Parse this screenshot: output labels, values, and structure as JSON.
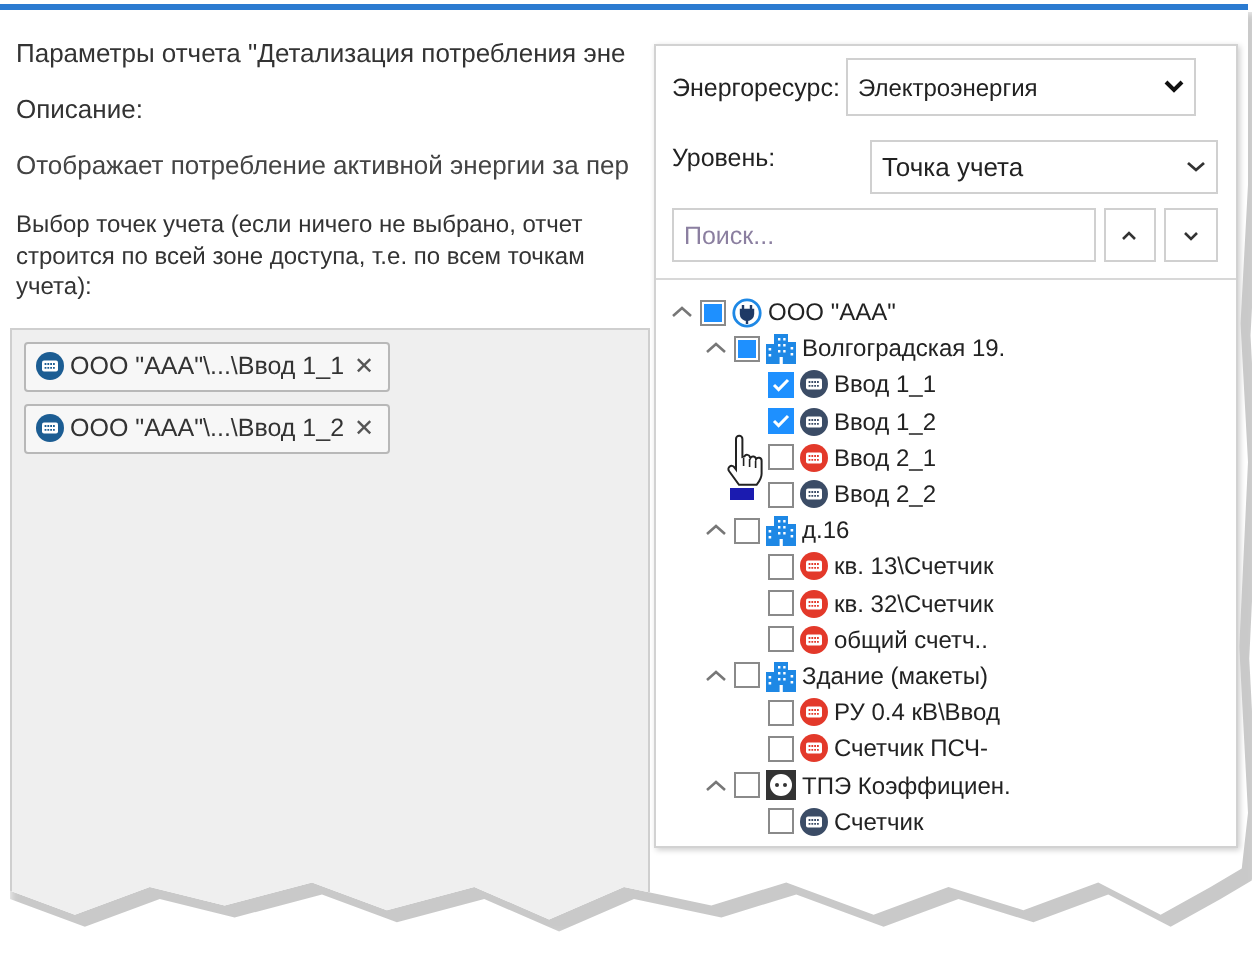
{
  "report": {
    "title": "Параметры отчета \"Детализация потребления эне",
    "description_label": "Описание:",
    "description": "Отображает потребление активной энергии за пер",
    "selection_hint": "Выбор точек учета (если ничего не выбрано, отчет строится по всей зоне доступа, т.е. по всем точкам учета):",
    "chips": [
      {
        "label": "ООО \"AAA\"\\...\\Ввод 1_1",
        "remove": "✕"
      },
      {
        "label": "ООО \"AAA\"\\...\\Ввод 1_2",
        "remove": "✕"
      }
    ]
  },
  "picker": {
    "resource_label": "Энергоресурс:",
    "resource_value": "Электроэнергия",
    "level_label": "Уровень:",
    "level_value": "Точка учета",
    "search": {
      "placeholder": "Поиск..."
    },
    "tree": [
      {
        "label": "ООО \"AAA\"",
        "kind": "organization",
        "checked": false,
        "partial": true,
        "expanded": true,
        "children": [
          {
            "label": "Волгоградская 19.",
            "kind": "building",
            "checked": false,
            "partial": true,
            "expanded": true,
            "children": [
              {
                "label": "Ввод 1_1",
                "kind": "meter",
                "color": "#3b4c66",
                "checked": true
              },
              {
                "label": "Ввод 1_2",
                "kind": "meter",
                "color": "#3b4c66",
                "checked": true
              },
              {
                "label": "Ввод 2_1",
                "kind": "meter",
                "color": "#e3392a",
                "checked": false
              },
              {
                "label": "Ввод 2_2",
                "kind": "meter",
                "color": "#3b4c66",
                "checked": false
              }
            ]
          },
          {
            "label": "д.16",
            "kind": "building",
            "checked": false,
            "partial": false,
            "expanded": true,
            "children": [
              {
                "label": "кв. 13\\Счетчик",
                "kind": "meter",
                "color": "#e3392a",
                "checked": false
              },
              {
                "label": "кв. 32\\Счетчик",
                "kind": "meter",
                "color": "#e3392a",
                "checked": false
              },
              {
                "label": "общий счетч..",
                "kind": "meter",
                "color": "#e3392a",
                "checked": false
              }
            ]
          },
          {
            "label": "Здание (макеты)",
            "kind": "building",
            "checked": false,
            "partial": false,
            "expanded": true,
            "children": [
              {
                "label": "РУ 0.4 кВ\\Ввод",
                "kind": "meter",
                "color": "#e3392a",
                "checked": false
              },
              {
                "label": "Счетчик ПСЧ-",
                "kind": "meter",
                "color": "#e3392a",
                "checked": false
              }
            ]
          },
          {
            "label": "ТПЭ Коэффициен.",
            "kind": "substation",
            "checked": false,
            "partial": false,
            "expanded": true,
            "children": [
              {
                "label": "Счетчик",
                "kind": "meter",
                "color": "#3b4c66",
                "checked": false
              }
            ]
          }
        ]
      }
    ]
  }
}
